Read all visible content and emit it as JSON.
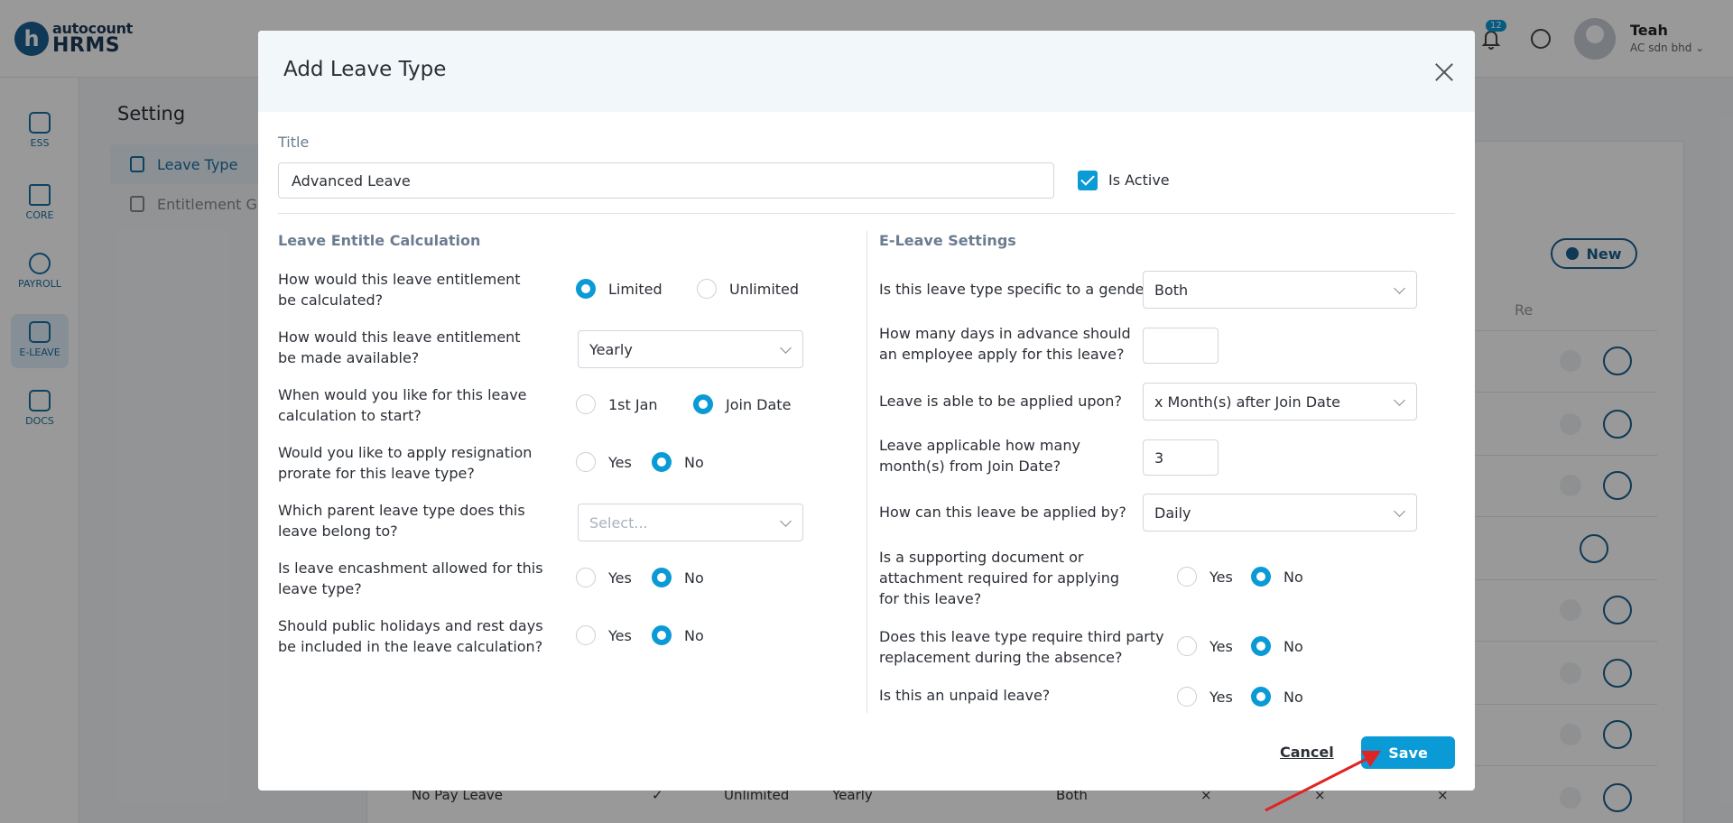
{
  "brand": {
    "top": "autocount",
    "bottom": "HRMS",
    "accent": "#0a9ad6",
    "primary": "#1a5f8f"
  },
  "header": {
    "notification_count": "12",
    "user_name": "Teah",
    "user_company": "AC sdn bhd"
  },
  "sidebar": {
    "items": [
      {
        "label": "ESS",
        "icon": "ess-icon"
      },
      {
        "label": "CORE",
        "icon": "core-icon"
      },
      {
        "label": "PAYROLL",
        "icon": "dollar-icon"
      },
      {
        "label": "E-LEAVE",
        "icon": "calendar-icon"
      },
      {
        "label": "DOCS",
        "icon": "docs-icon"
      }
    ]
  },
  "page": {
    "title": "Setting",
    "nav": [
      {
        "label": "Leave Type"
      },
      {
        "label": "Entitlement Gr"
      }
    ],
    "new_label": "New",
    "col_partial": "Re",
    "bottom_row": {
      "name": "No Pay Leave",
      "check": "✓",
      "calc": "Unlimited",
      "avail": "Yearly",
      "gender": "Both",
      "x": "×"
    }
  },
  "modal": {
    "title": "Add Leave Type",
    "title_label": "Title",
    "title_value": "Advanced Leave",
    "is_active_label": "Is Active",
    "is_active": true,
    "left_section": "Leave Entitle Calculation",
    "right_section": "E-Leave Settings",
    "left": {
      "q1": "How would this leave entitlement be calculated?",
      "q1_opt1": "Limited",
      "q1_opt2": "Unlimited",
      "q2": "How would this leave entitlement be made available?",
      "q2_value": "Yearly",
      "q3": "When would you like for this leave calculation to start?",
      "q3_opt1": "1st Jan",
      "q3_opt2": "Join Date",
      "q4": "Would you like to apply resignation prorate for this leave type?",
      "q5": "Which parent leave type does this leave belong to?",
      "q5_placeholder": "Select...",
      "q6": "Is leave encashment allowed for this leave type?",
      "q7": "Should public holidays and rest days be included in the leave calculation?"
    },
    "right": {
      "q1": "Is this leave type specific to a gender?",
      "q1_value": "Both",
      "q2": "How many days in advance should an employee apply for this leave?",
      "q2_value": "",
      "q3": "Leave is able to be applied upon?",
      "q3_value": "x Month(s) after Join Date",
      "q4": "Leave applicable how many month(s) from Join Date?",
      "q4_value": "3",
      "q5": "How can this leave be applied by?",
      "q5_value": "Daily",
      "q6": "Is a supporting document or attachment required for applying for this leave?",
      "q7": "Does this leave type require third party replacement during the absence?",
      "q8": "Is this an unpaid leave?"
    },
    "yes": "Yes",
    "no": "No",
    "cancel_label": "Cancel",
    "save_label": "Save"
  }
}
